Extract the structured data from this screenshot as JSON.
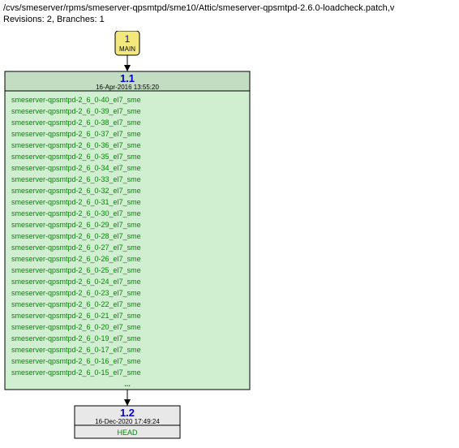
{
  "header": {
    "path": "/cvs/smeserver/rpms/smeserver-qpsmtpd/sme10/Attic/smeserver-qpsmtpd-2.6.0-loadcheck.patch,v",
    "meta": "Revisions: 2, Branches: 1"
  },
  "root": {
    "number": "1",
    "branch": "MAIN"
  },
  "rev11": {
    "title": "1.1",
    "date": "16-Apr-2016 13:55:20",
    "tags": [
      "smeserver-qpsmtpd-2_6_0-40_el7_sme",
      "smeserver-qpsmtpd-2_6_0-39_el7_sme",
      "smeserver-qpsmtpd-2_6_0-38_el7_sme",
      "smeserver-qpsmtpd-2_6_0-37_el7_sme",
      "smeserver-qpsmtpd-2_6_0-36_el7_sme",
      "smeserver-qpsmtpd-2_6_0-35_el7_sme",
      "smeserver-qpsmtpd-2_6_0-34_el7_sme",
      "smeserver-qpsmtpd-2_6_0-33_el7_sme",
      "smeserver-qpsmtpd-2_6_0-32_el7_sme",
      "smeserver-qpsmtpd-2_6_0-31_el7_sme",
      "smeserver-qpsmtpd-2_6_0-30_el7_sme",
      "smeserver-qpsmtpd-2_6_0-29_el7_sme",
      "smeserver-qpsmtpd-2_6_0-28_el7_sme",
      "smeserver-qpsmtpd-2_6_0-27_el7_sme",
      "smeserver-qpsmtpd-2_6_0-26_el7_sme",
      "smeserver-qpsmtpd-2_6_0-25_el7_sme",
      "smeserver-qpsmtpd-2_6_0-24_el7_sme",
      "smeserver-qpsmtpd-2_6_0-23_el7_sme",
      "smeserver-qpsmtpd-2_6_0-22_el7_sme",
      "smeserver-qpsmtpd-2_6_0-21_el7_sme",
      "smeserver-qpsmtpd-2_6_0-20_el7_sme",
      "smeserver-qpsmtpd-2_6_0-19_el7_sme",
      "smeserver-qpsmtpd-2_6_0-17_el7_sme",
      "smeserver-qpsmtpd-2_6_0-16_el7_sme",
      "smeserver-qpsmtpd-2_6_0-15_el7_sme"
    ],
    "more": "..."
  },
  "rev12": {
    "title": "1.2",
    "date": "16-Dec-2020 17:49:24",
    "branch": "HEAD"
  },
  "chart_data": {
    "type": "table",
    "title": "CVS revision graph",
    "nodes": [
      {
        "id": "1",
        "label": "1",
        "branch": "MAIN"
      },
      {
        "id": "1.1",
        "label": "1.1",
        "date": "16-Apr-2016 13:55:20",
        "tags_count": 25,
        "truncated": true
      },
      {
        "id": "1.2",
        "label": "1.2",
        "date": "16-Dec-2020 17:49:24",
        "branch": "HEAD"
      }
    ],
    "edges": [
      {
        "from": "1",
        "to": "1.1"
      },
      {
        "from": "1.1",
        "to": "1.2"
      }
    ]
  }
}
